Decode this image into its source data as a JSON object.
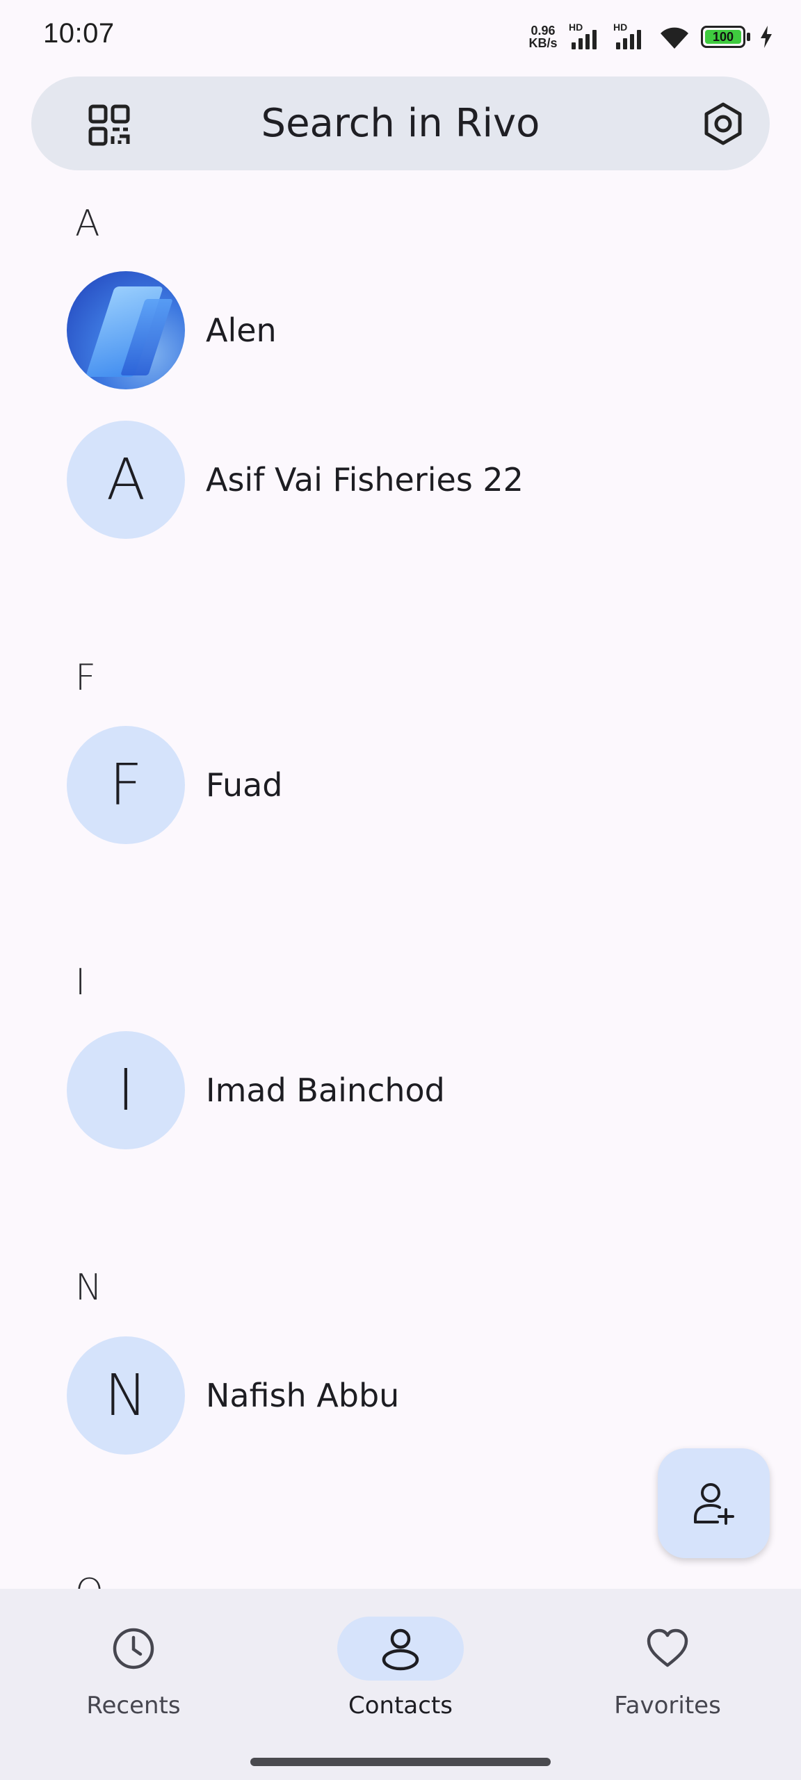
{
  "status_bar": {
    "time": "10:07",
    "net_speed_value": "0.96",
    "net_speed_unit": "KB/s",
    "hd_label_1": "HD",
    "hd_label_2": "HD",
    "battery": "100"
  },
  "search": {
    "placeholder": "Search in Rivo"
  },
  "contacts": {
    "sections": [
      {
        "letter": "A",
        "items": [
          {
            "name": "Alen",
            "initial": "",
            "has_photo": true
          },
          {
            "name": "Asif Vai Fisheries 22",
            "initial": "A"
          }
        ]
      },
      {
        "letter": "F",
        "items": [
          {
            "name": "Fuad",
            "initial": "F"
          }
        ]
      },
      {
        "letter": "I",
        "items": [
          {
            "name": "Imad Bainchod",
            "initial": "I"
          }
        ]
      },
      {
        "letter": "N",
        "items": [
          {
            "name": "Nafish Abbu",
            "initial": "N"
          }
        ]
      }
    ],
    "peek_letter": "O"
  },
  "bottom_nav": {
    "items": [
      {
        "label": "Recents",
        "icon": "clock-icon",
        "active": false
      },
      {
        "label": "Contacts",
        "icon": "person-icon",
        "active": true
      },
      {
        "label": "Favorites",
        "icon": "heart-icon",
        "active": false
      }
    ]
  },
  "colors": {
    "background": "#fcf8fd",
    "avatar": "#d5e3fb",
    "search_bar": "#e4e7ef",
    "nav_background": "#eeedf4"
  }
}
